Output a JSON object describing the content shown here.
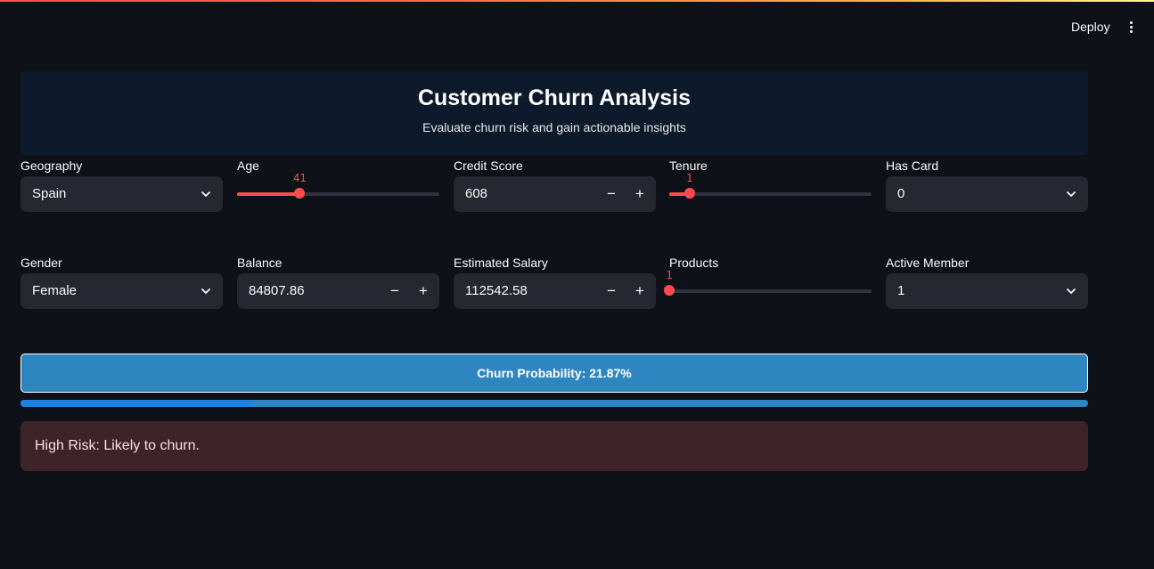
{
  "topbar": {
    "deploy_label": "Deploy",
    "menu_icon": "kebab-menu-icon"
  },
  "header": {
    "title": "Customer Churn Analysis",
    "subtitle": "Evaluate churn risk and gain actionable insights",
    "background": "#0c1a2b"
  },
  "inputs": {
    "geography": {
      "label": "Geography",
      "value": "Spain"
    },
    "age": {
      "label": "Age",
      "value": "41",
      "fill": 0.31
    },
    "credit_score": {
      "label": "Credit Score",
      "value": "608"
    },
    "tenure": {
      "label": "Tenure",
      "value": "1",
      "fill": 0.1
    },
    "has_card": {
      "label": "Has Card",
      "value": "0"
    },
    "gender": {
      "label": "Gender",
      "value": "Female"
    },
    "balance": {
      "label": "Balance",
      "value": "84807.86"
    },
    "estimated_salary": {
      "label": "Estimated Salary",
      "value": "112542.58"
    },
    "products": {
      "label": "Products",
      "value": "1",
      "fill": 0.0
    },
    "active_member": {
      "label": "Active Member",
      "value": "1"
    }
  },
  "stepper": {
    "minus": "−",
    "plus": "+"
  },
  "result": {
    "probability_text": "Churn Probability: 21.87%",
    "probability": 0.2187,
    "alert_text": "High Risk: Likely to churn."
  },
  "colors": {
    "accent": "#ff4b4b",
    "probability_box": "#2e86c1",
    "progress_fill": "#1c83e1",
    "alert_bg": "#3e2428"
  }
}
